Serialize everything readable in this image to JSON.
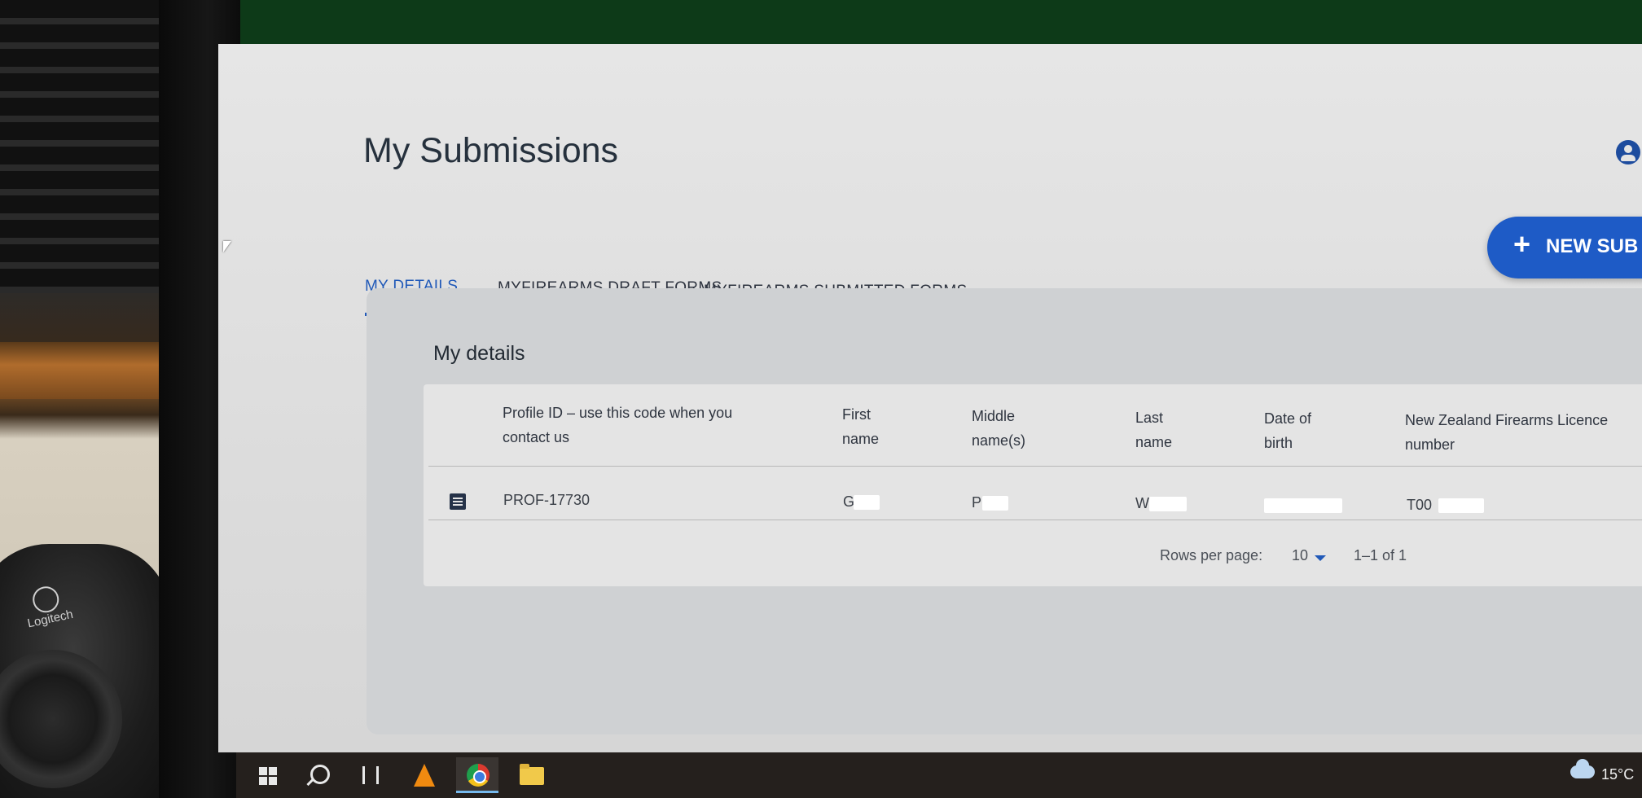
{
  "page": {
    "title": "My Submissions"
  },
  "tabs": [
    {
      "label": "MY DETAILS",
      "active": true
    },
    {
      "label": "MYFIREARMS DRAFT FORMS",
      "active": false
    },
    {
      "label": "MYFIREARMS SUBMITTED FORMS",
      "active": false
    }
  ],
  "new_button": {
    "label": "NEW SUB"
  },
  "details": {
    "title": "My details",
    "columns": [
      "Profile ID – use this code when you contact us",
      "First name",
      "Middle name(s)",
      "Last name",
      "Date of birth",
      "New Zealand Firearms Licence number"
    ],
    "rows": [
      {
        "profile_id": "PROF-17730",
        "first_name": "G",
        "middle_name": "P",
        "last_name": "W",
        "date_of_birth": "",
        "licence_number": "T00"
      }
    ],
    "pagination": {
      "rows_per_page_label": "Rows per page:",
      "rows_per_page_value": "10",
      "range": "1–1 of 1"
    }
  },
  "taskbar": {
    "temperature": "15°C"
  },
  "colors": {
    "accent": "#2059b8",
    "button": "#1e5bc6",
    "panel": "#cfd1d3"
  },
  "icons": [
    "user-icon",
    "plus-icon",
    "document-icon",
    "dropdown-caret-icon",
    "windows-start-icon",
    "search-icon",
    "task-view-icon",
    "vlc-icon",
    "chrome-icon",
    "file-explorer-icon",
    "cloud-icon"
  ]
}
